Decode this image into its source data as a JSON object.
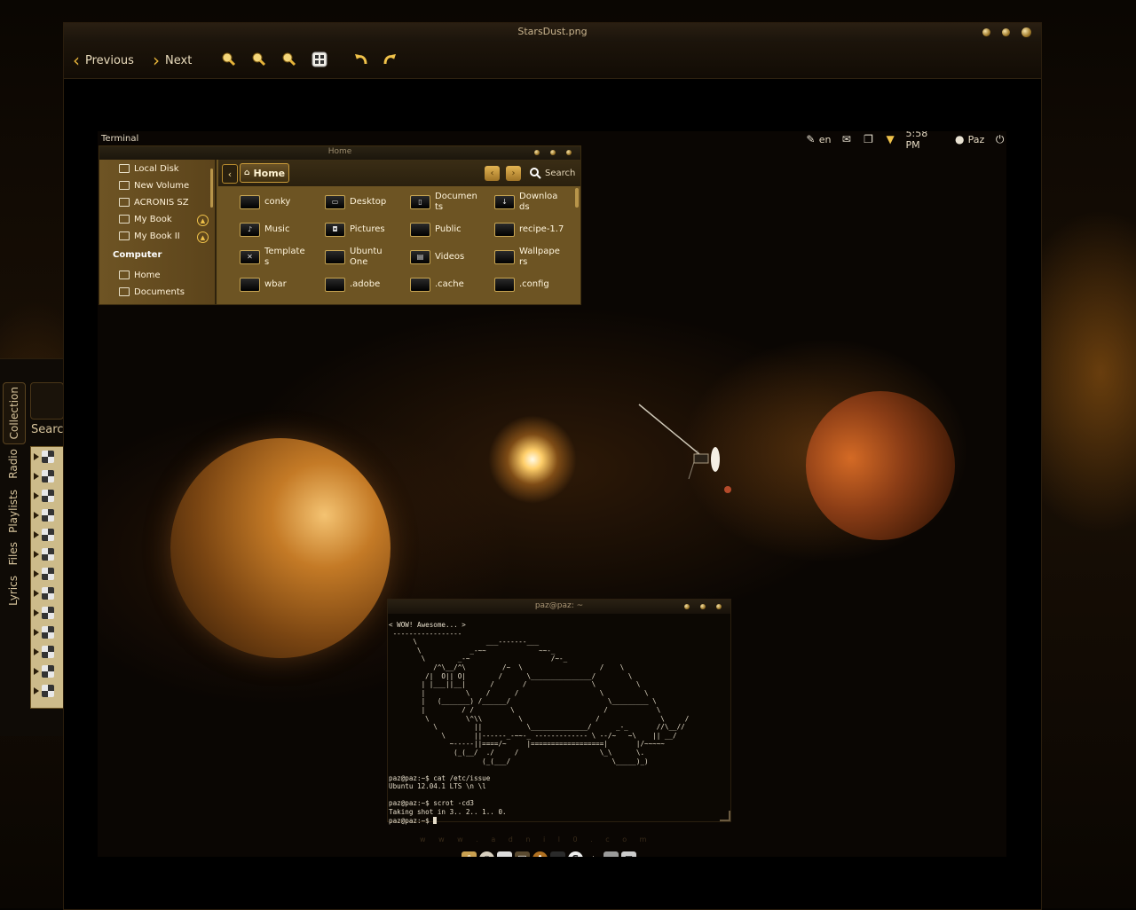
{
  "viewer": {
    "title": "StarsDust.png",
    "toolbar": {
      "previous": "Previous",
      "next": "Next"
    }
  },
  "panel": {
    "left_label": "Terminal",
    "lang": "en",
    "time": "5:58 PM",
    "user": "Paz"
  },
  "file_manager": {
    "title": "Home",
    "breadcrumb": "Home",
    "search": "Search",
    "devices": [
      "Local Disk",
      "New Volume",
      "ACRONIS SZ",
      "My Book",
      "My Book II"
    ],
    "section": "Computer",
    "places": [
      "Home",
      "Documents"
    ],
    "files": [
      {
        "name": "conky",
        "icon": "folder"
      },
      {
        "name": "Desktop",
        "icon": "desktop"
      },
      {
        "name": "Documen ts",
        "icon": "document"
      },
      {
        "name": "Downloa ds",
        "icon": "download"
      },
      {
        "name": "Music",
        "icon": "music"
      },
      {
        "name": "Pictures",
        "icon": "camera"
      },
      {
        "name": "Public",
        "icon": "folder"
      },
      {
        "name": "recipe-1.7",
        "icon": "folder"
      },
      {
        "name": "Template s",
        "icon": "template"
      },
      {
        "name": "Ubuntu One",
        "icon": "folder"
      },
      {
        "name": "Videos",
        "icon": "film"
      },
      {
        "name": "Wallpape rs",
        "icon": "folder"
      },
      {
        "name": "wbar",
        "icon": "folder"
      },
      {
        "name": ".adobe",
        "icon": "folder"
      },
      {
        "name": ".cache",
        "icon": "folder"
      },
      {
        "name": ".config",
        "icon": "folder"
      }
    ]
  },
  "terminal": {
    "title": "paz@paz: ~",
    "content": "< WOW! Awesome... >\n -----------------\n      \\                 ___-------___\n       \\            _-~~             ~~-_\n        \\        _-~                    /~-_\n           /^\\__/^\\         /~  \\                   /    \\\n         /|  O|| O|        /      \\_______________/        \\\n        | |___||__|      /       /                \\          \\\n        |          \\    /      /                    \\          \\\n        |   (_______) /______/                        \\_________ \\\n        |         / /         \\                      /            \\\n         \\         \\^\\\\         \\                  /               \\     /\n           \\         ||           \\______________/      _-_       //\\__//\n             \\       ||------_-~~-_ ------------- \\ --/~   ~\\    || __/\n               ~-----||====/~     |==================|       |/~~~~~\n                (_(__/  ./     /                    \\_\\      \\.\n                       (_(___/                         \\_____)_)\n\npaz@paz:~$ cat /etc/issue\nUbuntu 12.04.1 LTS \\n \\l\n\npaz@paz:~$ scrot -cd3\nTaking shot in 3.. 2.. 1.. 0.\npaz@paz:~$ "
  },
  "dock": {
    "label": "w w w . a d n i l 0 . c o m"
  },
  "music_player": {
    "search": "Search",
    "tabs": [
      "Collection",
      "Radio",
      "Playlists",
      "Files",
      "Lyrics"
    ]
  },
  "colors": {
    "accent": "#e5b33a",
    "panel_bg": "#6b5321",
    "background": "#050301"
  }
}
